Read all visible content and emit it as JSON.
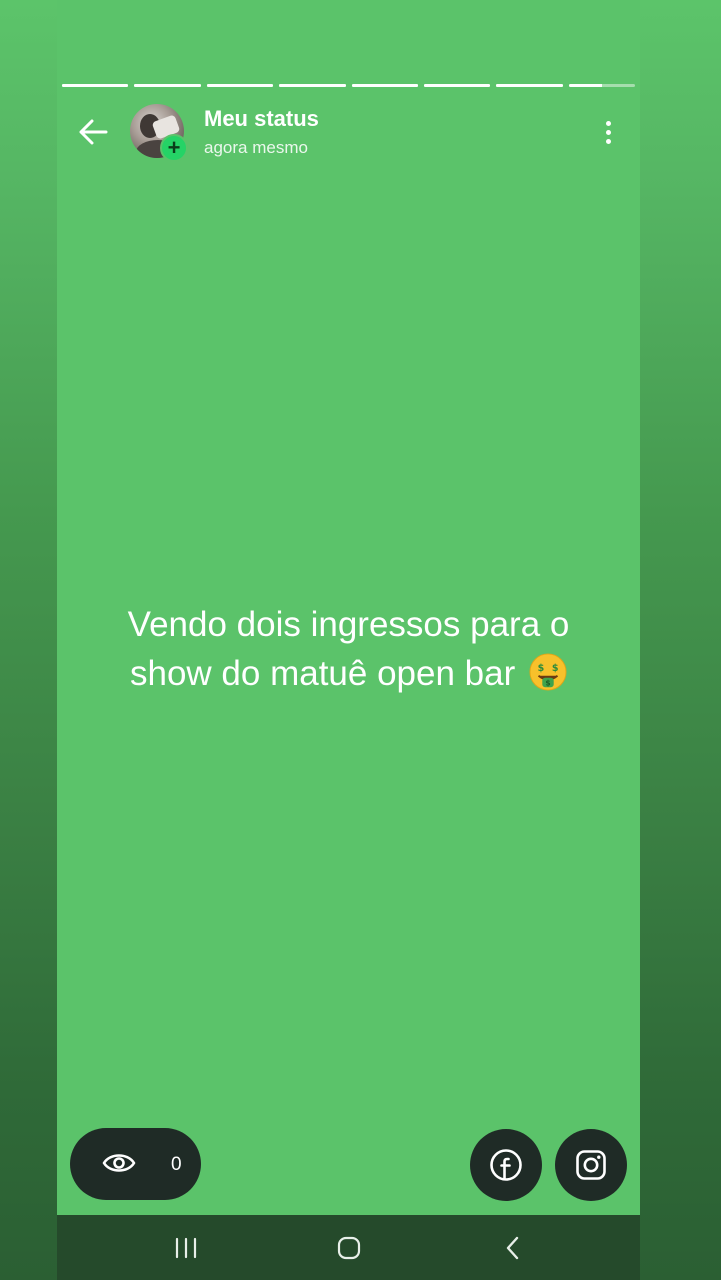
{
  "status": {
    "segments": [
      1,
      1,
      1,
      1,
      1,
      1,
      1,
      0.5
    ],
    "header": {
      "title": "Meu status",
      "subtitle": "agora mesmo",
      "add_badge": "+"
    },
    "text": "Vendo dois ingressos para o show do matuê open bar",
    "emoji": "money-mouth-face-emoji",
    "background_color": "#5bc36a",
    "views": {
      "count": "0",
      "icon": "eye-icon"
    },
    "share": [
      {
        "icon": "facebook-icon"
      },
      {
        "icon": "instagram-icon"
      }
    ]
  },
  "system_nav": {
    "buttons": [
      "recents-icon",
      "home-icon",
      "back-icon"
    ]
  },
  "colors": {
    "accent": "#25d366",
    "pill_bg": "#1f2b26",
    "nav_bg": "#254a2b"
  }
}
